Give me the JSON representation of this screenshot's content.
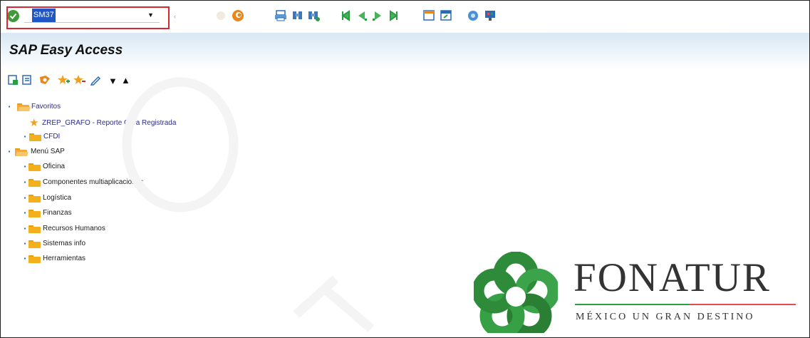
{
  "toolbar": {
    "command_value": "SM37",
    "icons": [
      "enter-check-icon",
      "back-icon",
      "exit-icon",
      "cancel-icon",
      "print-icon",
      "find-icon",
      "find-next-icon",
      "first-page-icon",
      "previous-page-icon",
      "next-page-icon",
      "last-page-icon",
      "create-session-icon",
      "shortcut-icon",
      "help-icon",
      "customize-layout-icon"
    ]
  },
  "title": "SAP Easy Access",
  "app_toolbar": [
    "user-menu-icon",
    "sap-menu-icon",
    "other-menu-icon",
    "add-favorite-icon",
    "delete-favorite-icon",
    "change-favorite-icon",
    "move-down-icon",
    "move-up-icon"
  ],
  "tree": {
    "favorites": {
      "label": "Favoritos",
      "items": [
        {
          "label": "ZREP_GRAFO - Reporte Obra Registrada",
          "type": "transaction"
        },
        {
          "label": "CFDI",
          "type": "folder"
        }
      ]
    },
    "sap_menu": {
      "label": "Menú SAP",
      "items": [
        {
          "label": "Oficina"
        },
        {
          "label": "Componentes multiaplicaciones"
        },
        {
          "label": "Logística"
        },
        {
          "label": "Finanzas"
        },
        {
          "label": "Recursos Humanos"
        },
        {
          "label": "Sistemas info"
        },
        {
          "label": "Herramientas"
        }
      ]
    }
  },
  "logo": {
    "name": "FONATUR",
    "tagline": "MÉXICO UN GRAN DESTINO"
  },
  "colors": {
    "highlight_border": "#d9262f",
    "selection": "#1f57c5",
    "folder": "#f2b01e",
    "logo_green": "#2e9f43",
    "logo_red": "#e24c52"
  }
}
